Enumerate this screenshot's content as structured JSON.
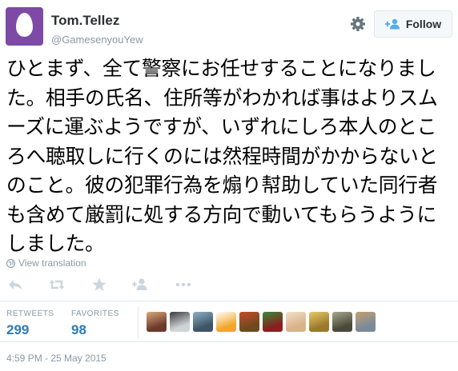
{
  "user": {
    "name": "Tom.Tellez",
    "handle": "@GamesenyouYew",
    "avatar_color": "#7d4aa5"
  },
  "follow_label": "Follow",
  "accent_color": "#2b7bb9",
  "tweet_text": "ひとまず、全て警察にお任せすることになりました。相手の氏名、住所等がわかれば事はよりスムーズに運ぶようですが、いずれにしろ本人のところへ聴取しに行くのには然程時間がかからないとのこと。彼の犯罪行為を煽り幇助していた同行者も含めて厳罰に処する方向で動いてもらうようにしました。",
  "translate_label": "View translation",
  "actions": [
    "reply-icon",
    "retweet-icon",
    "favorite-icon",
    "follow-user-icon",
    "more-icon"
  ],
  "stats": {
    "retweets_label": "RETWEETS",
    "retweets": "299",
    "favorites_label": "FAVORITES",
    "favorites": "98"
  },
  "favoriters": [
    {
      "color": "#6b3a2a",
      "accent": "#d9a87c"
    },
    {
      "color": "#cfd4d8",
      "accent": "#3a3a3a"
    },
    {
      "color": "#3d5566",
      "accent": "#8fb0c4"
    },
    {
      "color": "#f4a52a",
      "accent": "#ffffff"
    },
    {
      "color": "#6e4a1e",
      "accent": "#c94a2a"
    },
    {
      "color": "#8a1f1f",
      "accent": "#3a8a3a"
    },
    {
      "color": "#d8b28a",
      "accent": "#f3e0c8"
    },
    {
      "color": "#9a7a2a",
      "accent": "#e8c86a"
    },
    {
      "color": "#4a4a3a",
      "accent": "#a8a890"
    },
    {
      "color": "#7a8a9a",
      "accent": "#c4a070"
    }
  ],
  "timestamp": "4:59 PM - 25 May 2015"
}
